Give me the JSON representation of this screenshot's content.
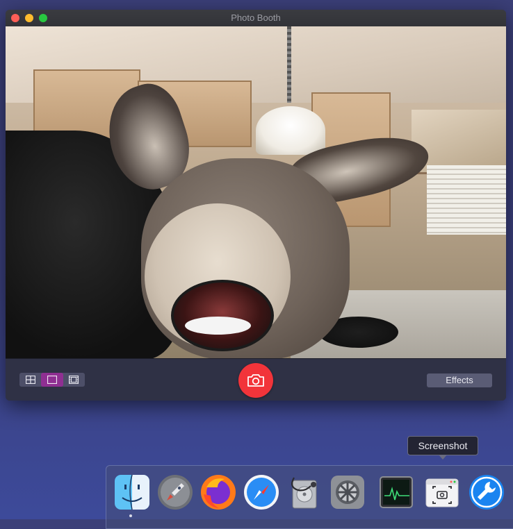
{
  "window": {
    "title": "Photo Booth",
    "controls": [
      "close",
      "minimize",
      "zoom"
    ]
  },
  "toolbar": {
    "layout_modes": [
      {
        "name": "four-up",
        "icon": "grid-four-icon",
        "active": false
      },
      {
        "name": "single",
        "icon": "single-frame-icon",
        "active": true
      },
      {
        "name": "movie",
        "icon": "film-strip-icon",
        "active": false
      }
    ],
    "shutter_icon": "camera-icon",
    "effects_label": "Effects",
    "colors": {
      "shutter": "#f2343a",
      "active_mode": "#8f2f92"
    }
  },
  "tooltip": {
    "text": "Screenshot"
  },
  "dock": {
    "items": [
      {
        "name": "Finder",
        "icon": "finder-icon",
        "running": true
      },
      {
        "name": "Launchpad",
        "icon": "rocket-icon",
        "running": false
      },
      {
        "name": "Firefox",
        "icon": "firefox-icon",
        "running": false
      },
      {
        "name": "Safari",
        "icon": "compass-icon",
        "running": false
      },
      {
        "name": "Disk Utility",
        "icon": "stethoscope-disk-icon",
        "running": false
      },
      {
        "name": "System Preferences",
        "icon": "gear-icon",
        "running": false
      },
      {
        "name": "Activity Monitor",
        "icon": "activity-monitor-icon",
        "running": false
      },
      {
        "name": "Screenshot",
        "icon": "screenshot-icon",
        "running": false
      },
      {
        "name": "Utility",
        "icon": "wrench-icon",
        "running": false
      }
    ]
  }
}
